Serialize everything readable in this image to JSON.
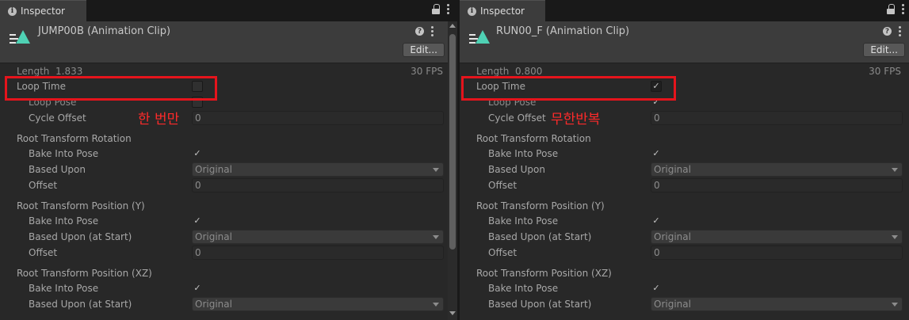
{
  "left_panel": {
    "tab_label": "Inspector",
    "clip_title": "JUMP00B (Animation Clip)",
    "edit_label": "Edit...",
    "length_text": "Length",
    "length_value": "1.833",
    "fps_text": "30 FPS",
    "loop_time_label": "Loop Time",
    "loop_time_checked": false,
    "loop_pose_label": "Loop Pose",
    "cycle_offset_label": "Cycle Offset",
    "cycle_offset_value": "0",
    "annotation": "한 번만",
    "rotation": {
      "header": "Root Transform Rotation",
      "bake_label": "Bake Into Pose",
      "based_label": "Based Upon",
      "based_value": "Original",
      "offset_label": "Offset",
      "offset_value": "0"
    },
    "position_y": {
      "header": "Root Transform Position (Y)",
      "bake_label": "Bake Into Pose",
      "based_label": "Based Upon (at Start)",
      "based_value": "Original",
      "offset_label": "Offset",
      "offset_value": "0"
    },
    "position_xz": {
      "header": "Root Transform Position (XZ)",
      "bake_label": "Bake Into Pose",
      "based_label": "Based Upon (at Start)",
      "based_value": "Original"
    }
  },
  "right_panel": {
    "tab_label": "Inspector",
    "clip_title": "RUN00_F (Animation Clip)",
    "edit_label": "Edit...",
    "length_text": "Length",
    "length_value": "0.800",
    "fps_text": "30 FPS",
    "loop_time_label": "Loop Time",
    "loop_time_checked": true,
    "loop_pose_label": "Loop Pose",
    "cycle_offset_label": "Cycle Offset",
    "cycle_offset_value": "0",
    "annotation": "무한반복",
    "rotation": {
      "header": "Root Transform Rotation",
      "bake_label": "Bake Into Pose",
      "based_label": "Based Upon",
      "based_value": "Original",
      "offset_label": "Offset",
      "offset_value": "0"
    },
    "position_y": {
      "header": "Root Transform Position (Y)",
      "bake_label": "Bake Into Pose",
      "based_label": "Based Upon (at Start)",
      "based_value": "Original",
      "offset_label": "Offset",
      "offset_value": "0"
    },
    "position_xz": {
      "header": "Root Transform Position (XZ)",
      "bake_label": "Bake Into Pose",
      "based_label": "Based Upon (at Start)",
      "based_value": "Original"
    }
  },
  "colors": {
    "annotation_red": "#e5141c",
    "clip_icon": "#4fd1b4"
  },
  "icons": [
    "info-icon",
    "lock-icon",
    "kebab-menu-icon",
    "animation-clip-icon",
    "help-icon",
    "checkmark-icon",
    "dropdown-arrow-icon"
  ]
}
